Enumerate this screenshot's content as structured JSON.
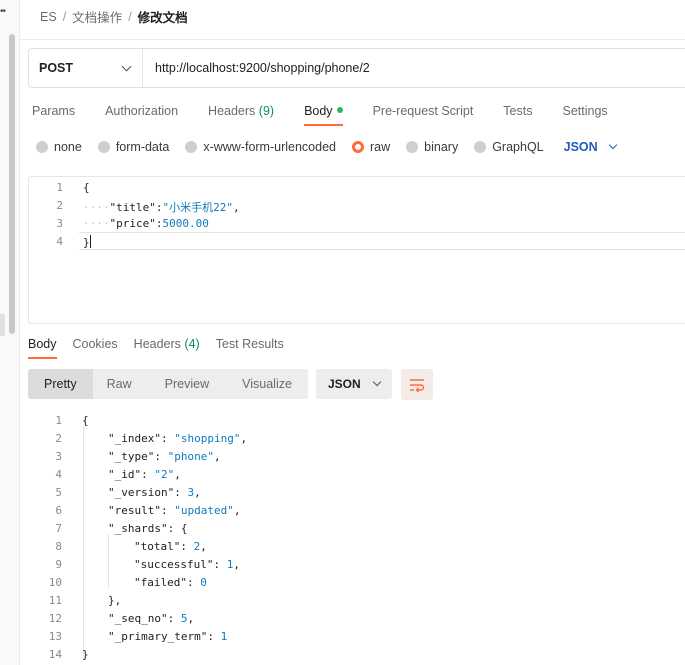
{
  "breadcrumb": {
    "items": [
      "ES",
      "文档操作"
    ],
    "current": "修改文档",
    "separator": "/"
  },
  "request": {
    "method": "POST",
    "url": "http://localhost:9200/shopping/phone/2"
  },
  "request_tabs": [
    {
      "label": "Params"
    },
    {
      "label": "Authorization"
    },
    {
      "label": "Headers",
      "count": "(9)"
    },
    {
      "label": "Body",
      "active": true
    },
    {
      "label": "Pre-request Script"
    },
    {
      "label": "Tests"
    },
    {
      "label": "Settings"
    }
  ],
  "body_types": [
    "none",
    "form-data",
    "x-www-form-urlencoded",
    "raw",
    "binary",
    "GraphQL"
  ],
  "body_type_selected": "raw",
  "body_language": "JSON",
  "request_body_lines": [
    {
      "no": "1",
      "text": "{"
    },
    {
      "no": "2",
      "key": "\"title\"",
      "value": "\"小米手机22\"",
      "tail": ","
    },
    {
      "no": "3",
      "key": "\"price\"",
      "value": "5000.00",
      "tail": ""
    },
    {
      "no": "4",
      "text": "}"
    }
  ],
  "response_tabs": [
    {
      "label": "Body",
      "active": true
    },
    {
      "label": "Cookies"
    },
    {
      "label": "Headers",
      "count": "(4)"
    },
    {
      "label": "Test Results"
    }
  ],
  "response_views": [
    "Pretty",
    "Raw",
    "Preview",
    "Visualize"
  ],
  "response_view_selected": "Pretty",
  "response_format": "JSON",
  "response_lines": [
    {
      "no": "1",
      "indent": 0,
      "text": "{"
    },
    {
      "no": "2",
      "indent": 1,
      "key": "\"_index\"",
      "value": "\"shopping\"",
      "tail": ","
    },
    {
      "no": "3",
      "indent": 1,
      "key": "\"_type\"",
      "value": "\"phone\"",
      "tail": ","
    },
    {
      "no": "4",
      "indent": 1,
      "key": "\"_id\"",
      "value": "\"2\"",
      "tail": ","
    },
    {
      "no": "5",
      "indent": 1,
      "key": "\"_version\"",
      "value": "3",
      "tail": ","
    },
    {
      "no": "6",
      "indent": 1,
      "key": "\"result\"",
      "value": "\"updated\"",
      "tail": ","
    },
    {
      "no": "7",
      "indent": 1,
      "key": "\"_shards\"",
      "value": "{",
      "tail": ""
    },
    {
      "no": "8",
      "indent": 2,
      "key": "\"total\"",
      "value": "2",
      "tail": ","
    },
    {
      "no": "9",
      "indent": 2,
      "key": "\"successful\"",
      "value": "1",
      "tail": ","
    },
    {
      "no": "10",
      "indent": 2,
      "key": "\"failed\"",
      "value": "0",
      "tail": ""
    },
    {
      "no": "11",
      "indent": 1,
      "text": "},"
    },
    {
      "no": "12",
      "indent": 1,
      "key": "\"_seq_no\"",
      "value": "5",
      "tail": ","
    },
    {
      "no": "13",
      "indent": 1,
      "key": "\"_primary_term\"",
      "value": "1",
      "tail": ""
    },
    {
      "no": "14",
      "indent": 0,
      "text": "}"
    }
  ],
  "colors": {
    "accent": "#ff6c37",
    "json_value": "#0d7bbd",
    "language_link": "#1f5cbf",
    "count_green": "#0a8f5a"
  }
}
